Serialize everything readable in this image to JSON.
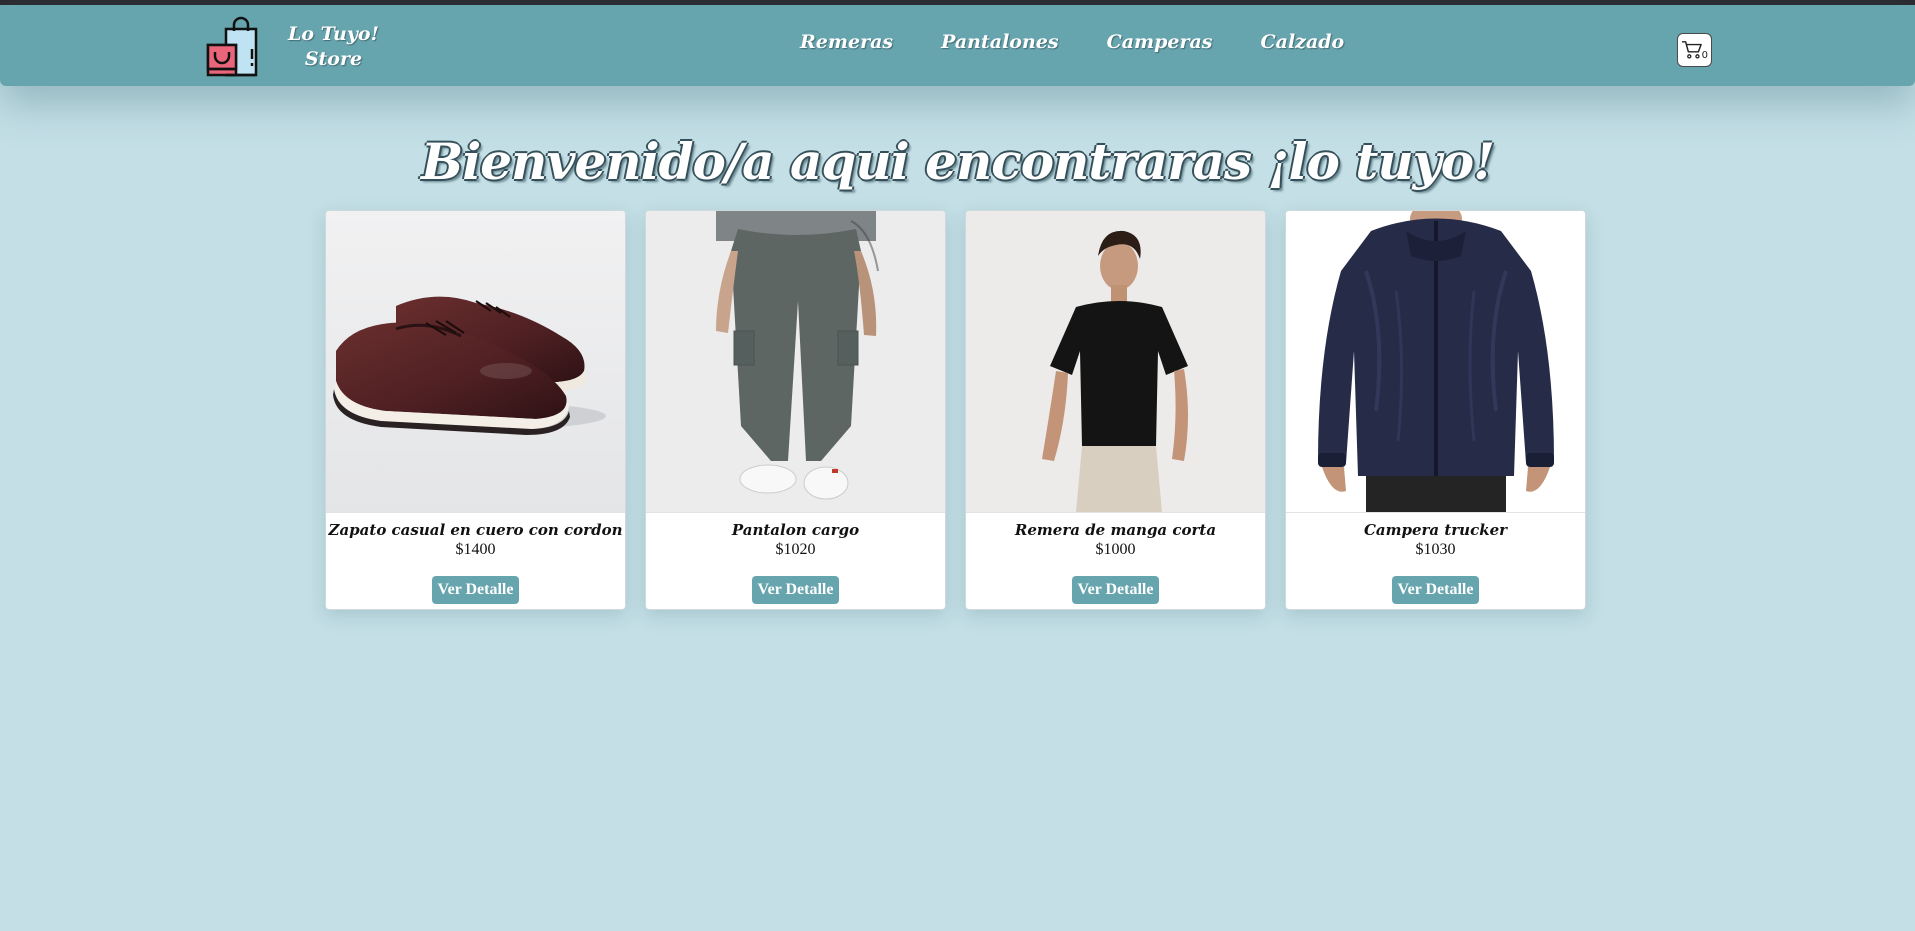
{
  "header": {
    "brand_line1": "Lo Tuyo!",
    "brand_line2": "Store",
    "nav": [
      {
        "label": "Remeras"
      },
      {
        "label": "Pantalones"
      },
      {
        "label": "Camperas"
      },
      {
        "label": "Calzado"
      }
    ],
    "cart_icon": "shopping-cart-icon",
    "cart_count": "0"
  },
  "main": {
    "title": "Bienvenido/a aqui encontraras ¡lo tuyo!",
    "products": [
      {
        "name": "Zapato casual en cuero con cordon",
        "price": "$1400",
        "button": "Ver Detalle",
        "image": "brown-leather-shoes"
      },
      {
        "name": "Pantalon cargo",
        "price": "$1020",
        "button": "Ver Detalle",
        "image": "grey-cargo-pants"
      },
      {
        "name": "Remera de manga corta",
        "price": "$1000",
        "button": "Ver Detalle",
        "image": "black-tshirt"
      },
      {
        "name": "Campera trucker",
        "price": "$1030",
        "button": "Ver Detalle",
        "image": "navy-jacket"
      }
    ]
  },
  "colors": {
    "page_bg": "#c4dfe6",
    "navbar": "#66a4ae",
    "button": "#66a4ae",
    "logo_pink": "#e8657a",
    "logo_blue": "#bfe3f3"
  }
}
